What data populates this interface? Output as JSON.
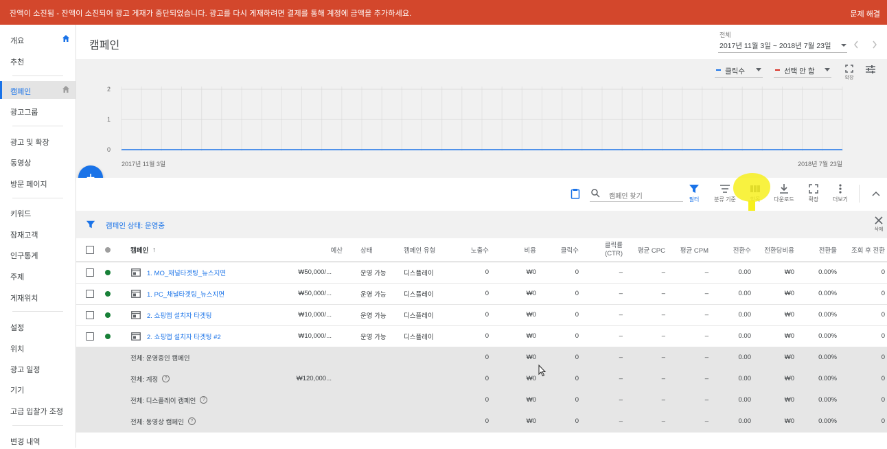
{
  "banner": {
    "message": "잔액이 소진됨 - 잔액이 소진되어 광고 게재가 중단되었습니다. 광고를 다시 게재하려면 결제를 통해 계정에 금액을 추가하세요.",
    "fix": "문제 해결",
    "color": "#d3472c"
  },
  "sidebar": {
    "items": [
      {
        "label": "개요"
      },
      {
        "label": "추천"
      },
      {
        "label": "캠페인"
      },
      {
        "label": "광고그룹"
      },
      {
        "label": "광고 및 확장"
      },
      {
        "label": "동영상"
      },
      {
        "label": "방문 페이지"
      },
      {
        "label": "키워드"
      },
      {
        "label": "잠재고객"
      },
      {
        "label": "인구통계"
      },
      {
        "label": "주제"
      },
      {
        "label": "게재위치"
      },
      {
        "label": "설정"
      },
      {
        "label": "위치"
      },
      {
        "label": "광고 일정"
      },
      {
        "label": "기기"
      },
      {
        "label": "고급 입찰가 조정"
      },
      {
        "label": "변경 내역"
      }
    ]
  },
  "header": {
    "title": "캠페인",
    "range_label": "전체",
    "range_value": "2017년 11월 3일 ~ 2018년 7월 23일"
  },
  "chart": {
    "metric1": "클릭수",
    "metric1_color": "#1a73e8",
    "metric2": "선택 안 함",
    "metric2_color": "#d93025",
    "expand_label": "확장",
    "y_ticks": [
      "2",
      "1",
      "0"
    ],
    "x_start": "2017년 11월 3일",
    "x_end": "2018년 7월 23일"
  },
  "toolbar": {
    "search_placeholder": "캠페인 찾기",
    "filter": "필터",
    "segment": "분류 기준",
    "columns": "항목",
    "download": "다운로드",
    "expand": "확장",
    "more": "더보기"
  },
  "filter": {
    "text": "캠페인 상태: 운영중",
    "remove": "삭제"
  },
  "table": {
    "headers": [
      "캠페인",
      "예산",
      "상태",
      "캠페인 유형",
      "노출수",
      "비용",
      "클릭수",
      "클릭률",
      "(CTR)",
      "평균 CPC",
      "평균 CPM",
      "전환수",
      "전환당비용",
      "전환율",
      "조회 후 전환"
    ],
    "rows": [
      {
        "name": "1. MO_채널타겟팅_뉴스지면",
        "budget": "₩50,000/...",
        "status": "운영 가능",
        "type": "디스플레이",
        "impr": "0",
        "cost": "₩0",
        "clicks": "0",
        "ctr": "–",
        "cpc": "–",
        "cpm": "–",
        "conv": "0.00",
        "cpa": "₩0",
        "cvr": "0.00%",
        "vtc": "0"
      },
      {
        "name": "1. PC_채널타겟팅_뉴스지면",
        "budget": "₩50,000/...",
        "status": "운영 가능",
        "type": "디스플레이",
        "impr": "0",
        "cost": "₩0",
        "clicks": "0",
        "ctr": "–",
        "cpc": "–",
        "cpm": "–",
        "conv": "0.00",
        "cpa": "₩0",
        "cvr": "0.00%",
        "vtc": "0"
      },
      {
        "name": "2. 쇼핑앱 설치자 타겟팅",
        "budget": "₩10,000/...",
        "status": "운영 가능",
        "type": "디스플레이",
        "impr": "0",
        "cost": "₩0",
        "clicks": "0",
        "ctr": "–",
        "cpc": "–",
        "cpm": "–",
        "conv": "0.00",
        "cpa": "₩0",
        "cvr": "0.00%",
        "vtc": "0"
      },
      {
        "name": "2. 쇼핑앱 설치자 타겟팅 #2",
        "budget": "₩10,000/...",
        "status": "운영 가능",
        "type": "디스플레이",
        "impr": "0",
        "cost": "₩0",
        "clicks": "0",
        "ctr": "–",
        "cpc": "–",
        "cpm": "–",
        "conv": "0.00",
        "cpa": "₩0",
        "cvr": "0.00%",
        "vtc": "0"
      }
    ],
    "summaries": [
      {
        "label": "전체: 운영중인 캠페인",
        "budget": "",
        "help": false
      },
      {
        "label": "전체: 계정",
        "budget": "₩120,000...",
        "help": true
      },
      {
        "label": "전체: 디스플레이 캠페인",
        "budget": "",
        "help": true
      },
      {
        "label": "전체: 동영상 캠페인",
        "budget": "",
        "help": true
      }
    ],
    "sum_values": {
      "impr": "0",
      "cost": "₩0",
      "clicks": "0",
      "ctr": "–",
      "cpc": "–",
      "cpm": "–",
      "conv": "0.00",
      "cpa": "₩0",
      "cvr": "0.00%",
      "vtc": "0"
    }
  }
}
